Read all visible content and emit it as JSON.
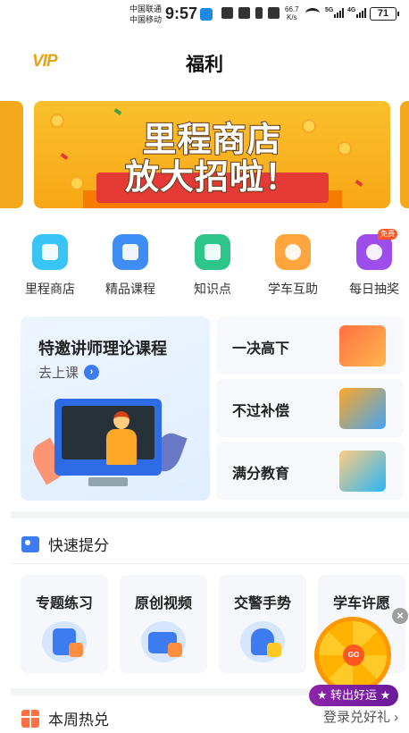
{
  "status_bar": {
    "carrier_1": "中国联通",
    "carrier_2": "中国移动",
    "time": "9:57",
    "net_speed_value": "66.7",
    "net_speed_unit": "K/s",
    "network_1": "5G",
    "network_2": "4G",
    "battery": "71"
  },
  "header": {
    "vip_label": "VIP",
    "title": "福利"
  },
  "banner": {
    "line_1": "里程商店",
    "line_2": "放大招啦！"
  },
  "quick_entries": [
    {
      "label": "里程商店",
      "icon": "store-icon",
      "color": "#38c4f5"
    },
    {
      "label": "精品课程",
      "icon": "video-course-icon",
      "color": "#3d8df5"
    },
    {
      "label": "知识点",
      "icon": "book-icon",
      "color": "#2dc58a"
    },
    {
      "label": "学车互助",
      "icon": "chat-bubble-icon",
      "color": "#ffa53d"
    },
    {
      "label": "每日抽奖",
      "icon": "lucky-wheel-icon",
      "color": "#9c4dea",
      "badge": "免费"
    }
  ],
  "courses": {
    "featured_title": "特邀讲师理论课程",
    "featured_link": "去上课",
    "cards": [
      {
        "label": "一决高下",
        "art": "pk-icon"
      },
      {
        "label": "不过补偿",
        "art": "car-pass-icon"
      },
      {
        "label": "满分教育",
        "art": "open-book-icon"
      }
    ]
  },
  "quick_improve": {
    "title": "快速提分",
    "items": [
      {
        "label": "专题练习",
        "icon": "notebook-pen-icon"
      },
      {
        "label": "原创视频",
        "icon": "video-screen-icon"
      },
      {
        "label": "交警手势",
        "icon": "traffic-hand-icon"
      },
      {
        "label": "学车许愿",
        "icon": "wish-icon"
      }
    ]
  },
  "floating_wheel": {
    "center_text": "GO",
    "button_label": "★ 转出好运 ★"
  },
  "weekly_hot": {
    "title": "本周热兑",
    "link": "登录兑好礼 ›"
  },
  "colors": {
    "accent": "#3d7cf0",
    "banner": "#f7a715",
    "vip": "#e4a418"
  }
}
